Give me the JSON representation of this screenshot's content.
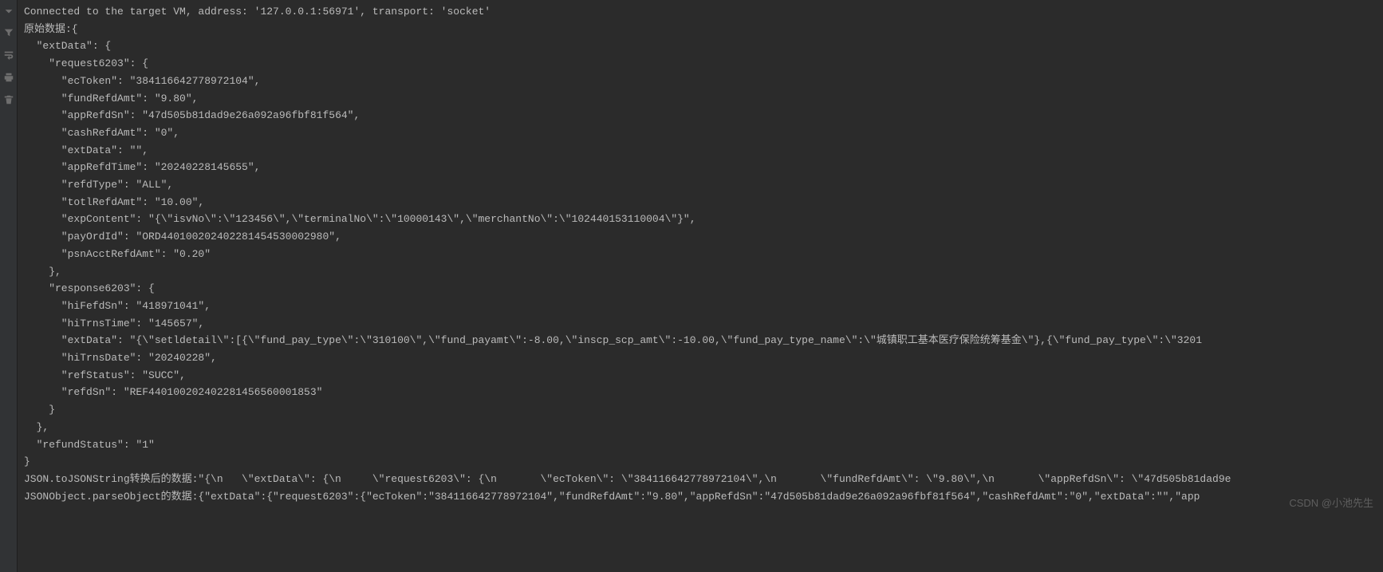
{
  "gutter": {
    "icons": [
      "arrow-down",
      "filter",
      "wrap-text",
      "print",
      "trash"
    ]
  },
  "console": {
    "lines": [
      "Connected to the target VM, address: '127.0.0.1:56971', transport: 'socket'",
      "原始数据:{",
      "  \"extData\": {",
      "    \"request6203\": {",
      "      \"ecToken\": \"384116642778972104\",",
      "      \"fundRefdAmt\": \"9.80\",",
      "      \"appRefdSn\": \"47d505b81dad9e26a092a96fbf81f564\",",
      "      \"cashRefdAmt\": \"0\",",
      "      \"extData\": \"\",",
      "      \"appRefdTime\": \"20240228145655\",",
      "      \"refdType\": \"ALL\",",
      "      \"totlRefdAmt\": \"10.00\",",
      "      \"expContent\": \"{\\\"isvNo\\\":\\\"123456\\\",\\\"terminalNo\\\":\\\"10000143\\\",\\\"merchantNo\\\":\\\"102440153110004\\\"}\",",
      "      \"payOrdId\": \"ORD440100202402281454530002980\",",
      "      \"psnAcctRefdAmt\": \"0.20\"",
      "    },",
      "    \"response6203\": {",
      "      \"hiFefdSn\": \"418971041\",",
      "      \"hiTrnsTime\": \"145657\",",
      "      \"extData\": \"{\\\"setldetail\\\":[{\\\"fund_pay_type\\\":\\\"310100\\\",\\\"fund_payamt\\\":-8.00,\\\"inscp_scp_amt\\\":-10.00,\\\"fund_pay_type_name\\\":\\\"城镇职工基本医疗保险统筹基金\\\"},{\\\"fund_pay_type\\\":\\\"3201",
      "      \"hiTrnsDate\": \"20240228\",",
      "      \"refStatus\": \"SUCC\",",
      "      \"refdSn\": \"REF440100202402281456560001853\"",
      "    }",
      "  },",
      "  \"refundStatus\": \"1\"",
      "}",
      "JSON.toJSONString转换后的数据:\"{\\n   \\\"extData\\\": {\\n     \\\"request6203\\\": {\\n       \\\"ecToken\\\": \\\"384116642778972104\\\",\\n       \\\"fundRefdAmt\\\": \\\"9.80\\\",\\n       \\\"appRefdSn\\\": \\\"47d505b81dad9e",
      "JSONObject.parseObject的数据:{\"extData\":{\"request6203\":{\"ecToken\":\"384116642778972104\",\"fundRefdAmt\":\"9.80\",\"appRefdSn\":\"47d505b81dad9e26a092a96fbf81f564\",\"cashRefdAmt\":\"0\",\"extData\":\"\",\"app"
    ]
  },
  "watermark": "CSDN @小池先生"
}
